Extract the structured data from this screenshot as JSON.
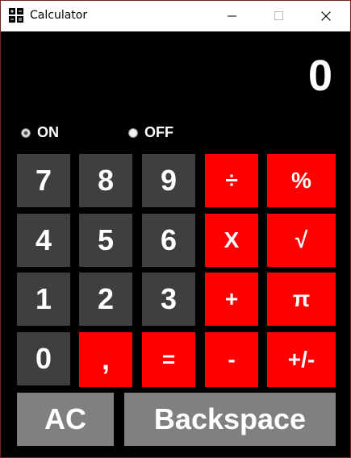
{
  "window": {
    "title": "Calculator"
  },
  "display": {
    "value": "0"
  },
  "power": {
    "on_label": "ON",
    "off_label": "OFF"
  },
  "keys": {
    "k7": "7",
    "k8": "8",
    "k9": "9",
    "divide": "÷",
    "percent": "%",
    "k4": "4",
    "k5": "5",
    "k6": "6",
    "multiply": "X",
    "sqrt": "√",
    "k1": "1",
    "k2": "2",
    "k3": "3",
    "plus": "+",
    "pi": "π",
    "k0": "0",
    "comma": ",",
    "equals": "=",
    "minus": "-",
    "negate": "+/-",
    "ac": "AC",
    "backspace": "Backspace"
  },
  "icons": {
    "app": "calculator-icon",
    "minimize": "minimize-icon",
    "maximize": "maximize-icon",
    "close": "close-icon"
  },
  "colors": {
    "background": "#000000",
    "number_key": "#3f3f3f",
    "operator_key": "#ff0000",
    "action_key": "#808080"
  }
}
